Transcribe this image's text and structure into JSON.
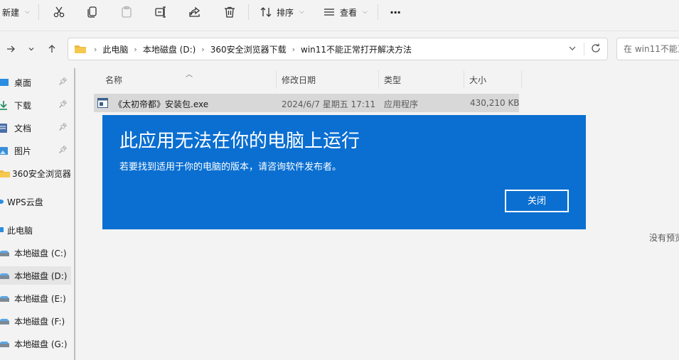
{
  "toolbar": {
    "new_label": "新建",
    "sort_label": "排序",
    "view_label": "查看",
    "more_label": "···"
  },
  "address": {
    "breadcrumbs": [
      "此电脑",
      "本地磁盘 (D:)",
      "360安全浏览器下载",
      "win11不能正常打开解决方法"
    ],
    "search_placeholder": "在 win11不能正"
  },
  "sidebar": {
    "items": [
      {
        "label": "桌面",
        "icon": "desktop-icon"
      },
      {
        "label": "下载",
        "icon": "download-icon"
      },
      {
        "label": "文档",
        "icon": "document-icon"
      },
      {
        "label": "图片",
        "icon": "picture-icon"
      },
      {
        "label": "360安全浏览器",
        "icon": "folder-icon"
      },
      {
        "label": "WPS云盘",
        "icon": "cloud-icon"
      },
      {
        "label": "此电脑",
        "icon": "computer-icon"
      },
      {
        "label": "本地磁盘 (C:)",
        "icon": "drive-icon"
      },
      {
        "label": "本地磁盘 (D:)",
        "icon": "drive-icon"
      },
      {
        "label": "本地磁盘 (E:)",
        "icon": "drive-icon"
      },
      {
        "label": "本地磁盘 (F:)",
        "icon": "drive-icon"
      },
      {
        "label": "本地磁盘 (G:)",
        "icon": "drive-icon"
      }
    ]
  },
  "list": {
    "columns": [
      "名称",
      "修改日期",
      "类型",
      "大小"
    ],
    "rows": [
      {
        "name": "《太初帝都》安装包.exe",
        "date": "2024/6/7 星期五 17:11",
        "type": "应用程序",
        "size": "430,210 KB"
      }
    ]
  },
  "preview": {
    "text": "没有预览"
  },
  "dialog": {
    "title": "此应用无法在你的电脑上运行",
    "message": "若要找到适用于你的电脑的版本，请咨询软件发布者。",
    "close_label": "关闭",
    "color": "#0a6fd1"
  }
}
